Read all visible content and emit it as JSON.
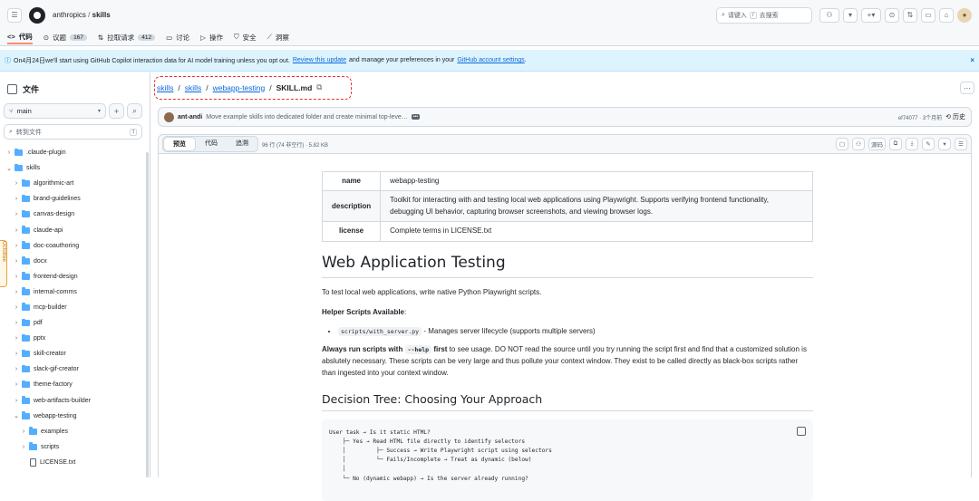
{
  "header": {
    "owner": "anthropics",
    "separator": "/",
    "repo": "skills",
    "search_placeholder": "请键入",
    "search_key": "/",
    "search_suffix": "去搜索"
  },
  "repo_nav": [
    {
      "label": "代码",
      "icon": "code-icon"
    },
    {
      "label": "议题",
      "count": "167",
      "icon": "issue-icon"
    },
    {
      "label": "拉取请求",
      "count": "412",
      "icon": "pull-request-icon"
    },
    {
      "label": "讨论",
      "icon": "discussion-icon"
    },
    {
      "label": "操作",
      "icon": "play-icon"
    },
    {
      "label": "安全",
      "icon": "shield-icon"
    },
    {
      "label": "洞察",
      "icon": "graph-icon"
    }
  ],
  "banner": {
    "text_before": "On4月24日we'll start using GitHub Copilot interaction data for AI model training unless you opt out.",
    "link1": "Review this update",
    "text_middle": "and manage your preferences in your",
    "link2": "GitHub account settings",
    "text_after": ".",
    "close": "×"
  },
  "sidebar": {
    "title": "文件",
    "branch": "main",
    "add": "+",
    "search": "⌕",
    "goto_placeholder": "转到文件",
    "goto_key": "t",
    "octotree": "Octotree",
    "tree": [
      {
        "name": ".claude-plugin",
        "type": "folder",
        "depth": 0,
        "open": false
      },
      {
        "name": "skills",
        "type": "folder",
        "depth": 0,
        "open": true
      },
      {
        "name": "algorithmic-art",
        "type": "folder",
        "depth": 1,
        "open": false
      },
      {
        "name": "brand-guidelines",
        "type": "folder",
        "depth": 1,
        "open": false
      },
      {
        "name": "canvas-design",
        "type": "folder",
        "depth": 1,
        "open": false
      },
      {
        "name": "claude-api",
        "type": "folder",
        "depth": 1,
        "open": false
      },
      {
        "name": "doc-coauthoring",
        "type": "folder",
        "depth": 1,
        "open": false
      },
      {
        "name": "docx",
        "type": "folder",
        "depth": 1,
        "open": false
      },
      {
        "name": "frontend-design",
        "type": "folder",
        "depth": 1,
        "open": false
      },
      {
        "name": "internal-comms",
        "type": "folder",
        "depth": 1,
        "open": false
      },
      {
        "name": "mcp-builder",
        "type": "folder",
        "depth": 1,
        "open": false
      },
      {
        "name": "pdf",
        "type": "folder",
        "depth": 1,
        "open": false
      },
      {
        "name": "pptx",
        "type": "folder",
        "depth": 1,
        "open": false
      },
      {
        "name": "skill-creator",
        "type": "folder",
        "depth": 1,
        "open": false
      },
      {
        "name": "slack-gif-creator",
        "type": "folder",
        "depth": 1,
        "open": false
      },
      {
        "name": "theme-factory",
        "type": "folder",
        "depth": 1,
        "open": false
      },
      {
        "name": "web-artifacts-builder",
        "type": "folder",
        "depth": 1,
        "open": false
      },
      {
        "name": "webapp-testing",
        "type": "folder",
        "depth": 1,
        "open": true
      },
      {
        "name": "examples",
        "type": "folder",
        "depth": 2,
        "open": false
      },
      {
        "name": "scripts",
        "type": "folder",
        "depth": 2,
        "open": false
      },
      {
        "name": "LICENSE.txt",
        "type": "file",
        "depth": 2,
        "open": false
      }
    ]
  },
  "breadcrumb": {
    "parts": [
      "skills",
      "skills",
      "webapp-testing"
    ],
    "current": "SKILL.md",
    "sep": "/"
  },
  "commit": {
    "author": "ant-andi",
    "message": "Move example skills into dedicated folder and create minimal top-leve…",
    "dots": "•••",
    "meta": "ef74077 · 3个月前",
    "history": "历史"
  },
  "file_header": {
    "tabs": [
      "预览",
      "代码",
      "追溯"
    ],
    "active_tab": 0,
    "info": "96 行 (74 非空行) · 5.82 KB",
    "raw": "源码",
    "more": "⋯"
  },
  "meta_table": [
    {
      "key": "name",
      "value": "webapp-testing"
    },
    {
      "key": "description",
      "value": "Toolkit for interacting with and testing local web applications using Playwright. Supports verifying frontend functionality, debugging UI behavior, capturing browser screenshots, and viewing browser logs."
    },
    {
      "key": "license",
      "value": "Complete terms in LICENSE.txt"
    }
  ],
  "doc": {
    "h1": "Web Application Testing",
    "intro": "To test local web applications, write native Python Playwright scripts.",
    "helper_title": "Helper Scripts Available",
    "helper_colon": ":",
    "helper_code": "scripts/with_server.py",
    "helper_text": "- Manages server lifecycle (supports multiple servers)",
    "always_bold": "Always run scripts with",
    "always_code": "--help",
    "always_bold2": "first",
    "always_text": "to see usage. DO NOT read the source until you try running the script first and find that a customized solution is abslutely necessary. These scripts can be very large and thus pollute your context window. They exist to be called directly as black-box scripts rather than ingested into your context window.",
    "h2": "Decision Tree: Choosing Your Approach",
    "code": "User task → Is it static HTML?\n    ├─ Yes → Read HTML file directly to identify selectors\n    │         ├─ Success → Write Playwright script using selectors\n    │         └─ Fails/Incomplete → Treat as dynamic (below)\n    │\n    └─ No (dynamic webapp) → Is the server already running?"
  }
}
